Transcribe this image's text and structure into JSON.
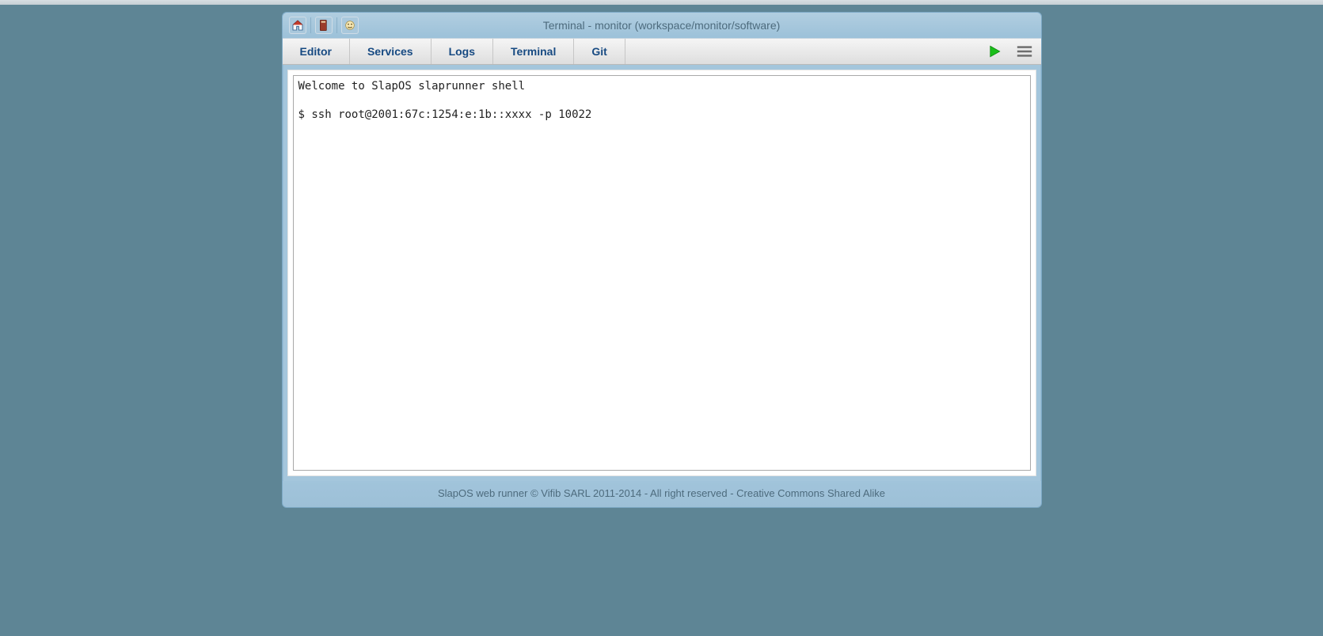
{
  "titlebar": {
    "title": "Terminal - monitor (workspace/monitor/software)"
  },
  "tabs": {
    "editor": "Editor",
    "services": "Services",
    "logs": "Logs",
    "terminal": "Terminal",
    "git": "Git"
  },
  "terminal": {
    "line1": "Welcome to SlapOS slaprunner shell",
    "line2": "",
    "line3": "$ ssh root@2001:67c:1254:e:1b::xxxx -p 10022"
  },
  "footer": {
    "text": "SlapOS web runner © Vifib SARL 2011-2014 - All right reserved - Creative Commons Shared Alike"
  }
}
